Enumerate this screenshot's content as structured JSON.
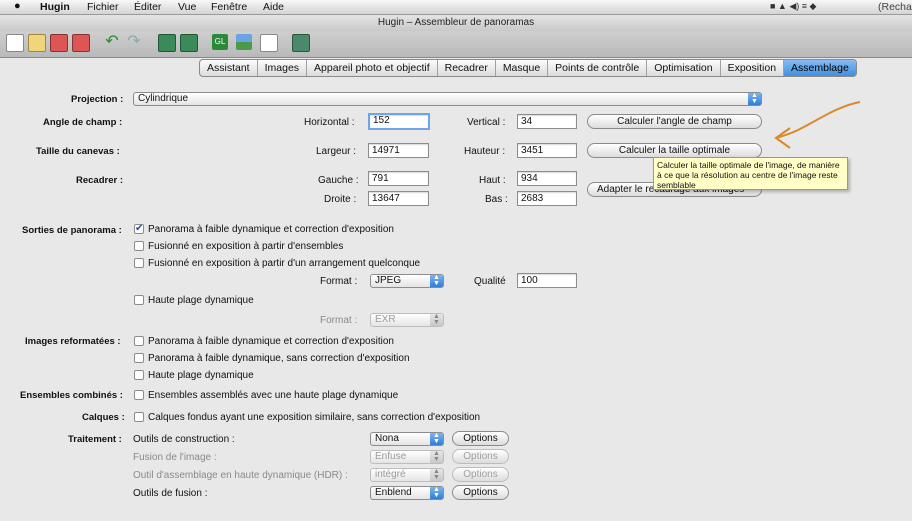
{
  "menubar": {
    "apple_icon": "apple-icon",
    "app_name": "Hugin",
    "items": [
      "Fichier",
      "Éditer",
      "Vue",
      "Fenêtre",
      "Aide"
    ],
    "search_label": "(Recha"
  },
  "window": {
    "title": "Hugin – Assembleur de panoramas"
  },
  "tabs": [
    {
      "label": "Assistant",
      "active": false
    },
    {
      "label": "Images",
      "active": false
    },
    {
      "label": "Appareil photo et objectif",
      "active": false
    },
    {
      "label": "Recadrer",
      "active": false
    },
    {
      "label": "Masque",
      "active": false
    },
    {
      "label": "Points de contrôle",
      "active": false
    },
    {
      "label": "Optimisation",
      "active": false
    },
    {
      "label": "Exposition",
      "active": false
    },
    {
      "label": "Assemblage",
      "active": true
    }
  ],
  "projection": {
    "label": "Projection :",
    "value": "Cylindrique"
  },
  "angle": {
    "label": "Angle de champ :",
    "h_label": "Horizontal :",
    "h_value": "152",
    "v_label": "Vertical :",
    "v_value": "34",
    "button": "Calculer l'angle de champ"
  },
  "canvas": {
    "label": "Taille du canevas :",
    "w_label": "Largeur :",
    "w_value": "14971",
    "h_label": "Hauteur :",
    "h_value": "3451",
    "button": "Calculer la taille optimale"
  },
  "crop": {
    "label": "Recadrer :",
    "left_label": "Gauche :",
    "left_value": "791",
    "top_label": "Haut :",
    "top_value": "934",
    "right_label": "Droite :",
    "right_value": "13647",
    "bottom_label": "Bas :",
    "bottom_value": "2683",
    "button": "Adapter le recadrage aux images"
  },
  "tooltip": {
    "text": "Calculer la taille optimale de l'image, de manière à ce que la résolution au centre de l'image reste semblable"
  },
  "outputs": {
    "label": "Sorties de panorama :",
    "opt1": "Panorama à faible dynamique et correction d'exposition",
    "opt2": "Fusionné en exposition à partir d'ensembles",
    "opt3": "Fusionné en exposition à partir d'un arrangement quelconque",
    "format_label": "Format :",
    "format_value": "JPEG",
    "quality_label": "Qualité",
    "quality_value": "100",
    "hdr_opt": "Haute plage dynamique",
    "hdr_format_label": "Format :",
    "hdr_format_value": "EXR"
  },
  "remapped": {
    "label": "Images reformatées :",
    "opt1": "Panorama à faible dynamique et correction d'exposition",
    "opt2": "Panorama à faible dynamique, sans correction d'exposition",
    "opt3": "Haute plage dynamique"
  },
  "combined": {
    "label": "Ensembles combinés :",
    "opt1": "Ensembles assemblés avec une haute plage dynamique"
  },
  "layers": {
    "label": "Calques :",
    "opt1": "Calques fondus ayant une exposition similaire, sans correction d'exposition"
  },
  "processing": {
    "label": "Traitement :",
    "rows": [
      {
        "label": "Outils de construction :",
        "value": "Nona",
        "button": "Options",
        "enabled": true
      },
      {
        "label": "Fusion de l'image :",
        "value": "Enfuse",
        "button": "Options",
        "enabled": false
      },
      {
        "label": "Outil d'assemblage en haute dynamique (HDR) :",
        "value": "intégré",
        "button": "Options",
        "enabled": false
      },
      {
        "label": "Outils de fusion :",
        "value": "Enblend",
        "button": "Options",
        "enabled": true
      }
    ]
  },
  "annotation_color": "#d98a2a"
}
